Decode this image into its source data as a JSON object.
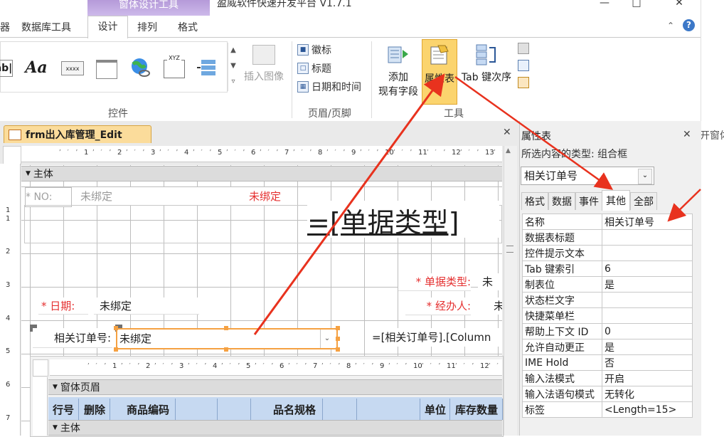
{
  "window": {
    "context_tab": "窗体设计工具",
    "title": "盈威软件快速开发平台 V1.7.1",
    "help_icon": "question-icon"
  },
  "ribbon": {
    "tabs": [
      "数据库工具",
      "设计",
      "排列",
      "格式"
    ],
    "partial_left_tab": "器",
    "groups": {
      "controls": "控件",
      "header_footer": "页眉/页脚",
      "tools": "工具"
    },
    "insert_image": "插入图像",
    "header_items": [
      "徽标",
      "标题",
      "日期和时间"
    ],
    "add_existing_fields": "添加\n现有字段",
    "add_existing_fields_l1": "添加",
    "add_existing_fields_l2": "现有字段",
    "property_sheet": "属性表",
    "tab_order": "Tab 键次序",
    "control_labels": [
      "ab|",
      "Aa",
      "xxxx",
      "XYZ"
    ]
  },
  "right_strip": {
    "text": "开窗体"
  },
  "document": {
    "tab_title": "frm出入库管理_Edit",
    "ruler_numbers": [
      "1",
      "2",
      "3",
      "4",
      "5",
      "6",
      "7",
      "8",
      "9",
      "10",
      "11",
      "12",
      "13",
      "14"
    ],
    "section_main": "主体",
    "no_label": "* NO:",
    "unbound_1": "未绑定",
    "unbound_red": "未绑定",
    "big_expression": "=[单据类型]",
    "doc_type_label": "* 单据类型:",
    "doc_type_value": "未绑",
    "date_label": "* 日期:",
    "date_value": "未绑定",
    "handler_label": "* 经办人:",
    "handler_value": "未",
    "order_label": "相关订单号:",
    "order_value": "未绑定",
    "order_expr": "=[相关订单号].[Column",
    "vruler_numbers": [
      "1",
      "1",
      "2",
      "3",
      "4",
      "5",
      "6",
      "7"
    ]
  },
  "subform": {
    "ruler_numbers": [
      "1",
      "2",
      "3",
      "4",
      "5",
      "6",
      "7",
      "8",
      "9",
      "10",
      "11",
      "12",
      "13"
    ],
    "header_section": "窗体页眉",
    "columns": [
      "行号",
      "删除",
      "商品编码",
      "品名规格",
      "单位",
      "库存数量"
    ],
    "body_section": "主体"
  },
  "property_sheet": {
    "title": "属性表",
    "selection_type": "所选内容的类型: 组合框",
    "selected_object": "相关订单号",
    "tabs": [
      "格式",
      "数据",
      "事件",
      "其他",
      "全部"
    ],
    "active_tab": "其他",
    "rows": [
      {
        "name": "名称",
        "value": "相关订单号"
      },
      {
        "name": "数据表标题",
        "value": ""
      },
      {
        "name": "控件提示文本",
        "value": ""
      },
      {
        "name": "Tab 键索引",
        "value": "6"
      },
      {
        "name": "制表位",
        "value": "是"
      },
      {
        "name": "状态栏文字",
        "value": ""
      },
      {
        "name": "快捷菜单栏",
        "value": ""
      },
      {
        "name": "帮助上下文 ID",
        "value": "0"
      },
      {
        "name": "允许自动更正",
        "value": "是"
      },
      {
        "name": "IME Hold",
        "value": "否"
      },
      {
        "name": "输入法模式",
        "value": "开启"
      },
      {
        "name": "输入法语句模式",
        "value": "无转化"
      },
      {
        "name": "标签",
        "value": "<Length=15>"
      }
    ]
  },
  "colors": {
    "context_tab": "#b59ad9",
    "active_button": "#fbd46e",
    "doc_tab": "#fbdc9b",
    "selection": "#f5a142",
    "required_label": "#e53030",
    "arrow": "#e8321e"
  }
}
